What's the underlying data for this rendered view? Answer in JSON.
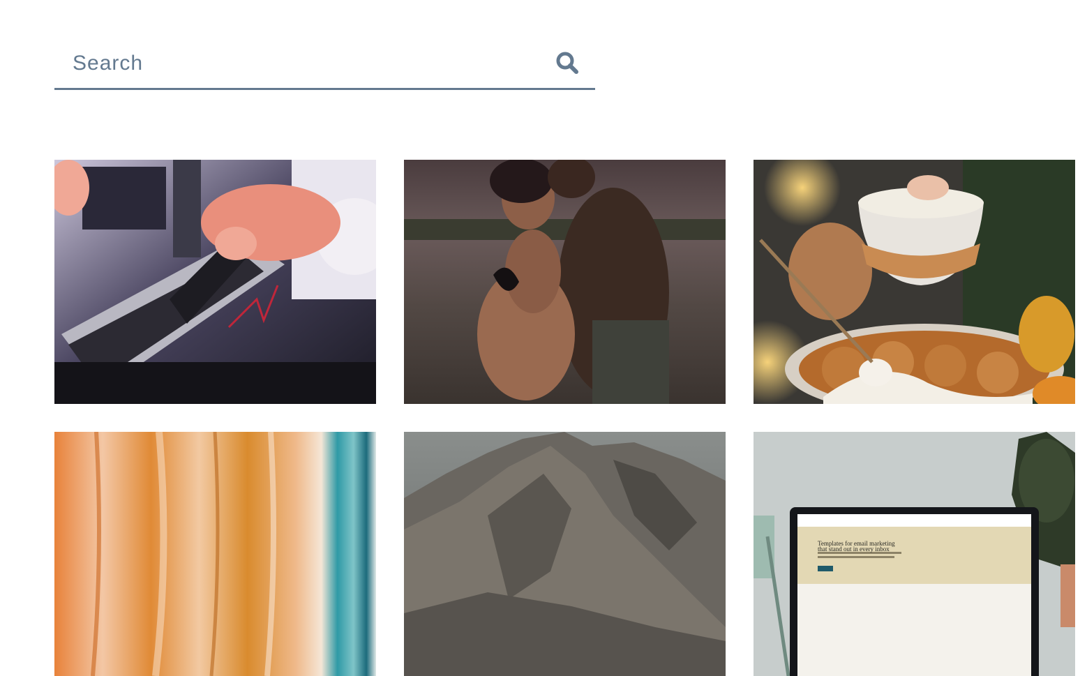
{
  "search": {
    "placeholder": "Search",
    "value": "",
    "icon": "search-icon",
    "color": "#63798f"
  },
  "gallery": {
    "photos": [
      {
        "subject": "hand inserting SSD into PC"
      },
      {
        "subject": "couple embracing on beach at dusk"
      },
      {
        "subject": "cinnamon rolls with cream and pumpkins"
      },
      {
        "subject": "orange and teal abstract painting"
      },
      {
        "subject": "rocky mountain peak"
      },
      {
        "subject": "laptop showing email template website"
      }
    ],
    "laptop_screen": {
      "headline_line1": "Templates for email marketing",
      "headline_line2": "that stand out in every inbox"
    }
  }
}
